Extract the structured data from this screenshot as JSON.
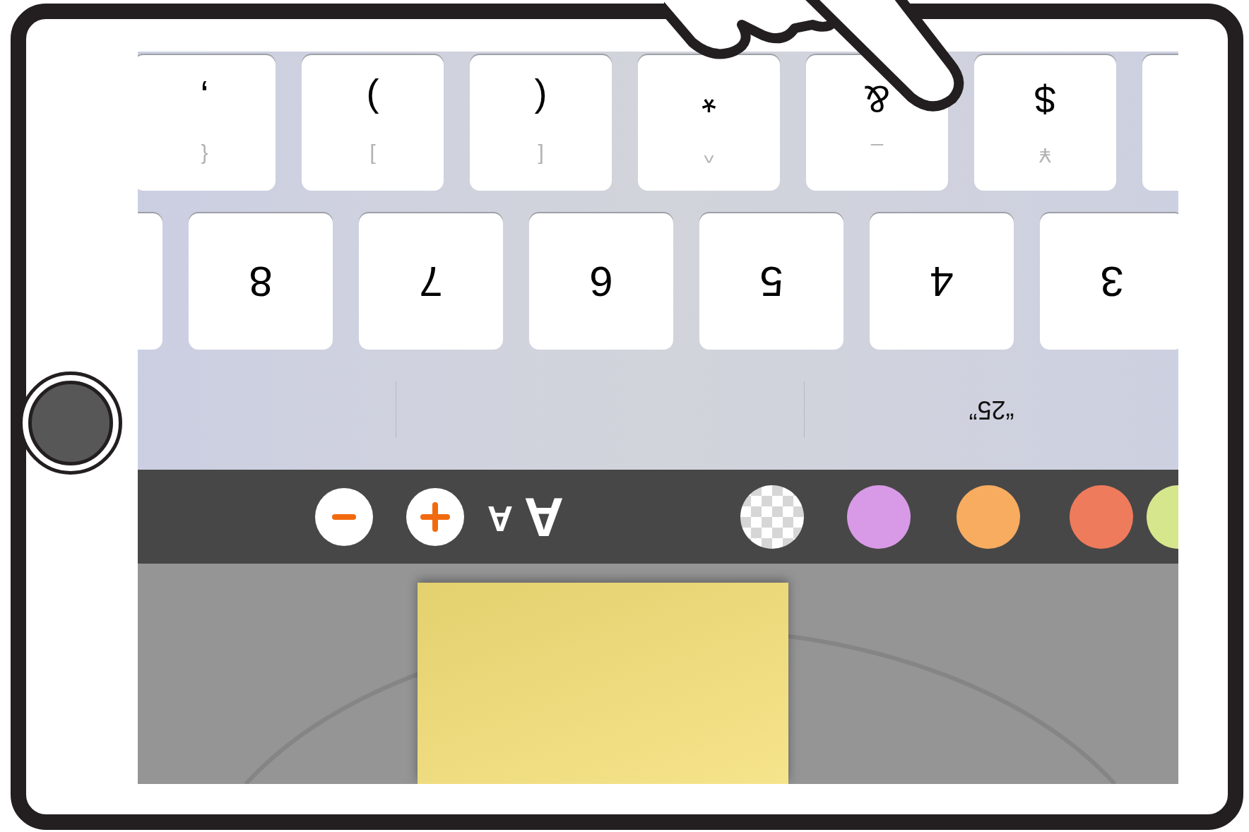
{
  "toolbar": {
    "font_size_labels": [
      "A",
      "A"
    ],
    "colors": [
      {
        "kind": "solid",
        "color": "#d6e68c"
      },
      {
        "kind": "solid",
        "color": "#ee7b5c"
      },
      {
        "kind": "solid",
        "color": "#f8ac60"
      },
      {
        "kind": "solid",
        "color": "#d89ae6"
      },
      {
        "kind": "transparent"
      }
    ]
  },
  "suggestions": [
    "“25”"
  ],
  "number_row": [
    "3",
    "4",
    "5",
    "6",
    "7",
    "8"
  ],
  "symbol_row": [
    {
      "main": "$",
      "hint": "¥"
    },
    {
      "main": "&",
      "hint": "_"
    },
    {
      "main": "*",
      "hint": "^"
    },
    {
      "main": "(",
      "hint": "["
    },
    {
      "main": ")",
      "hint": "]"
    },
    {
      "main": ",",
      "hint": "{"
    }
  ]
}
